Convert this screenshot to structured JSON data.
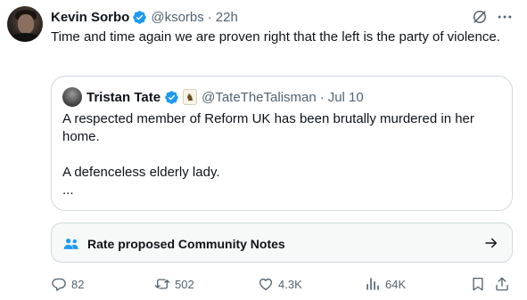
{
  "author": {
    "name": "Kevin Sorbo",
    "handle": "@ksorbs",
    "separator": "·",
    "time": "22h"
  },
  "tweet_text": "Time and time again we are proven right that the left is the party of violence.",
  "quote": {
    "name": "Tristan Tate",
    "handle": "@TateTheTalisman",
    "separator": "·",
    "time": "Jul 10",
    "badge_icon": "chess-knight-icon",
    "lines": [
      "A respected member of Reform UK has been brutally murdered in her home.",
      "A defenceless elderly lady.",
      "..."
    ]
  },
  "community_notes": {
    "label": "Rate proposed Community Notes",
    "icon": "people-icon"
  },
  "actions": {
    "replies": "82",
    "reposts": "502",
    "likes": "4.3K",
    "views": "64K"
  },
  "colors": {
    "verified": "#1d9bf0",
    "secondary_text": "#536471",
    "border": "#cfd9de",
    "notes_bg": "#f7f9f9"
  }
}
